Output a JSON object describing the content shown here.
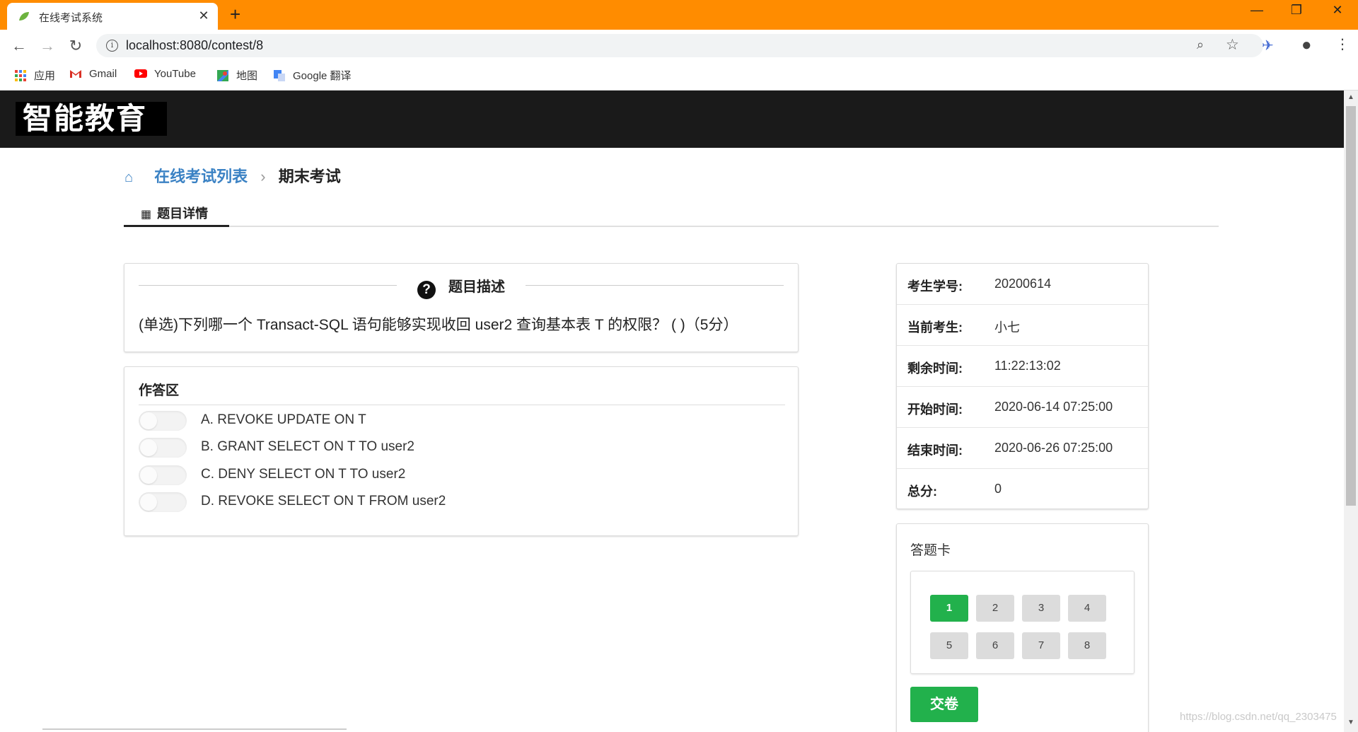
{
  "browser": {
    "tab_title": "在线考试系统",
    "tab_close": "✕",
    "new_tab": "+",
    "url": "localhost:8080/contest/8",
    "window_controls": {
      "minimize": "—",
      "restore": "❐",
      "close": "✕"
    },
    "bookmarks": [
      {
        "label": "应用",
        "icon": "apps-grid-icon"
      },
      {
        "label": "Gmail",
        "icon": "gmail-icon"
      },
      {
        "label": "YouTube",
        "icon": "youtube-icon"
      },
      {
        "label": "地图",
        "icon": "maps-icon"
      },
      {
        "label": "Google 翻译",
        "icon": "translate-icon"
      }
    ]
  },
  "navbar": {
    "logo_text": "智能教育"
  },
  "breadcrumb": {
    "home_icon": "home-icon",
    "list_link": "在线考试列表",
    "separator": "›",
    "current": "期末考试"
  },
  "tabs": {
    "detail_label": "题目详情"
  },
  "question": {
    "section_title": "题目描述",
    "text": "(单选)下列哪一个 Transact-SQL 语句能够实现收回 user2 查询基本表 T 的权限？   (  )（5分）"
  },
  "answer": {
    "title": "作答区",
    "options": [
      {
        "text": "A.  REVOKE UPDATE ON T",
        "selected": false
      },
      {
        "text": "B.  GRANT SELECT ON T TO user2",
        "selected": false
      },
      {
        "text": "C.  DENY SELECT ON T TO user2",
        "selected": false
      },
      {
        "text": "D.  REVOKE SELECT ON T FROM user2",
        "selected": false
      }
    ]
  },
  "exam_info": [
    {
      "label": "考生学号:",
      "value": "20200614"
    },
    {
      "label": "当前考生:",
      "value": "小七"
    },
    {
      "label": "剩余时间:",
      "value": "11:22:13:02"
    },
    {
      "label": "开始时间:",
      "value": "2020-06-14 07:25:00"
    },
    {
      "label": "结束时间:",
      "value": "2020-06-26 07:25:00"
    },
    {
      "label": "总分:",
      "value": "0"
    }
  ],
  "answer_card": {
    "title": "答题卡",
    "questions": [
      "1",
      "2",
      "3",
      "4",
      "5",
      "6",
      "7",
      "8"
    ],
    "current": "1",
    "submit_label": "交卷"
  },
  "colors": {
    "tabbar": "#ff8c00",
    "accent_green": "#22b14c",
    "link_blue": "#3b82c4",
    "navbar": "#1a1a1a"
  },
  "watermark": "https://blog.csdn.net/qq_2303475"
}
